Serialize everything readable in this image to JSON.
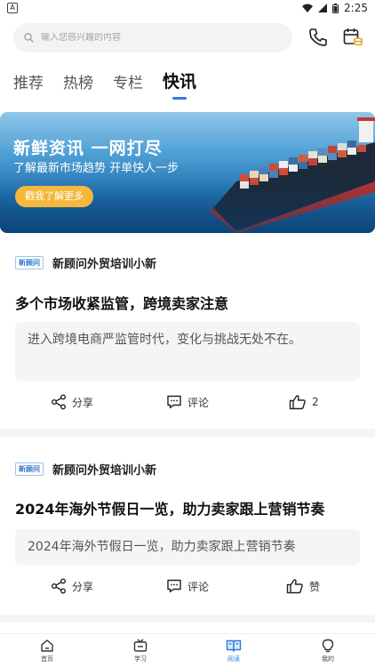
{
  "status_bar": {
    "time": "2:25",
    "app_glyph": "A"
  },
  "search": {
    "placeholder": "输入您感兴趣的内容"
  },
  "header_icons": [
    "phone-icon",
    "calendar-coins-icon"
  ],
  "tabs": [
    {
      "label": "推荐"
    },
    {
      "label": "热榜"
    },
    {
      "label": "专栏"
    },
    {
      "label": "快讯",
      "active": true
    }
  ],
  "banner": {
    "title": "新鲜资讯  一网打尽",
    "subtitle": "了解最新市场趋势 开单快人一步",
    "cta": "戳我了解更多"
  },
  "articles": [
    {
      "source_logo": "新顾问",
      "source": "新顾问外贸培训小新",
      "title": "多个市场收紧监管，跨境卖家注意",
      "summary": "进入跨境电商严监管时代，变化与挑战无处不在。",
      "share": "分享",
      "comment": "评论",
      "likes": "2"
    },
    {
      "source_logo": "新顾问",
      "source": "新顾问外贸培训小新",
      "title": "2024年海外节假日一览，助力卖家跟上营销节奏",
      "summary": "2024年海外节假日一览，助力卖家跟上营销节奏",
      "share": "分享",
      "comment": "评论",
      "likes": "赞"
    }
  ],
  "nav": [
    {
      "label": "首页",
      "icon": "home-icon"
    },
    {
      "label": "学习",
      "icon": "tv-icon"
    },
    {
      "label": "阅读",
      "icon": "book-icon",
      "active": true
    },
    {
      "label": "我的",
      "icon": "bulb-icon"
    }
  ],
  "colors": {
    "accent": "#2f7be0",
    "cta": "#f5b83c"
  }
}
